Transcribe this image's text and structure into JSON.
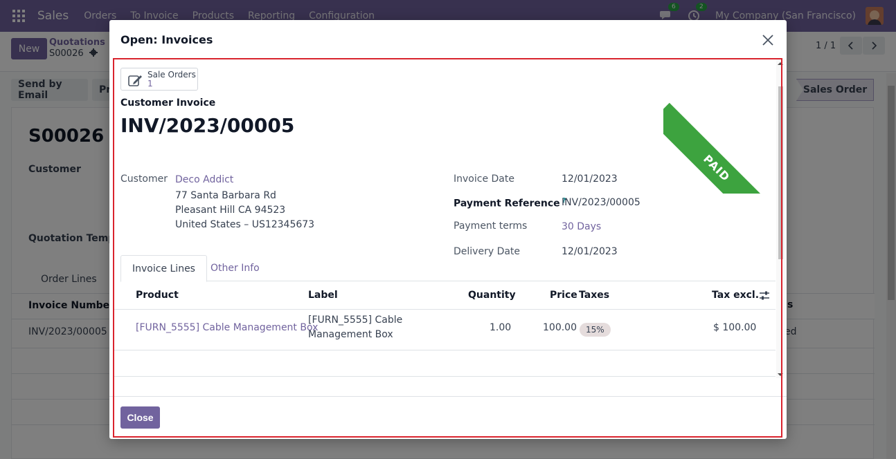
{
  "navbar": {
    "brand": "Sales",
    "menus": [
      "Orders",
      "To Invoice",
      "Products",
      "Reporting",
      "Configuration"
    ],
    "messages_count": "6",
    "activities_count": "2",
    "company": "My Company (San Francisco)"
  },
  "control_panel": {
    "new_label": "New",
    "breadcrumb_parent": "Quotations",
    "breadcrumb_current": "S00026",
    "pager": "1 / 1"
  },
  "background": {
    "send_email_label": "Send by Email",
    "print_label_fragment": "Pr",
    "status_stage": "Sales Order",
    "record_name": "S00026",
    "customer_label": "Customer",
    "quotation_template_label": "Quotation Templa",
    "tab_order_lines": "Order Lines",
    "col_invoice_number": "Invoice Number",
    "col_status_fragment": "s",
    "row_invoice_number": "INV/2023/00005",
    "row_status_fragment": "ed"
  },
  "modal": {
    "title": "Open: Invoices",
    "smart_button": {
      "label": "Sale Orders",
      "count": "1"
    },
    "document_type": "Customer Invoice",
    "invoice_number": "INV/2023/00005",
    "ribbon": "PAID",
    "customer": {
      "label": "Customer",
      "name": "Deco Addict",
      "address_line1": "77 Santa Barbara Rd",
      "address_line2": "Pleasant Hill CA 94523",
      "address_line3": "United States – US12345673"
    },
    "invoice_date": {
      "label": "Invoice Date",
      "value": "12/01/2023"
    },
    "payment_reference": {
      "label": "Payment Reference",
      "help": "?",
      "value": "INV/2023/00005"
    },
    "payment_terms": {
      "label": "Payment terms",
      "value": "30 Days"
    },
    "delivery_date": {
      "label": "Delivery Date",
      "value": "12/01/2023"
    },
    "tabs": [
      {
        "label": "Invoice Lines"
      },
      {
        "label": "Other Info"
      }
    ],
    "lines": {
      "headers": {
        "product": "Product",
        "label": "Label",
        "quantity": "Quantity",
        "price": "Price",
        "taxes": "Taxes",
        "tax_excl": "Tax excl."
      },
      "rows": [
        {
          "product": "[FURN_5555] Cable Management Box",
          "label_line1": "[FURN_5555] Cable",
          "label_line2": "Management Box",
          "quantity": "1.00",
          "price": "100.00",
          "tax": "15%",
          "subtotal": "$ 100.00"
        }
      ]
    },
    "close_label": "Close"
  },
  "colors": {
    "brand": "#71639e",
    "paid_ribbon": "#3da33f",
    "highlight_frame": "#d9232d"
  }
}
